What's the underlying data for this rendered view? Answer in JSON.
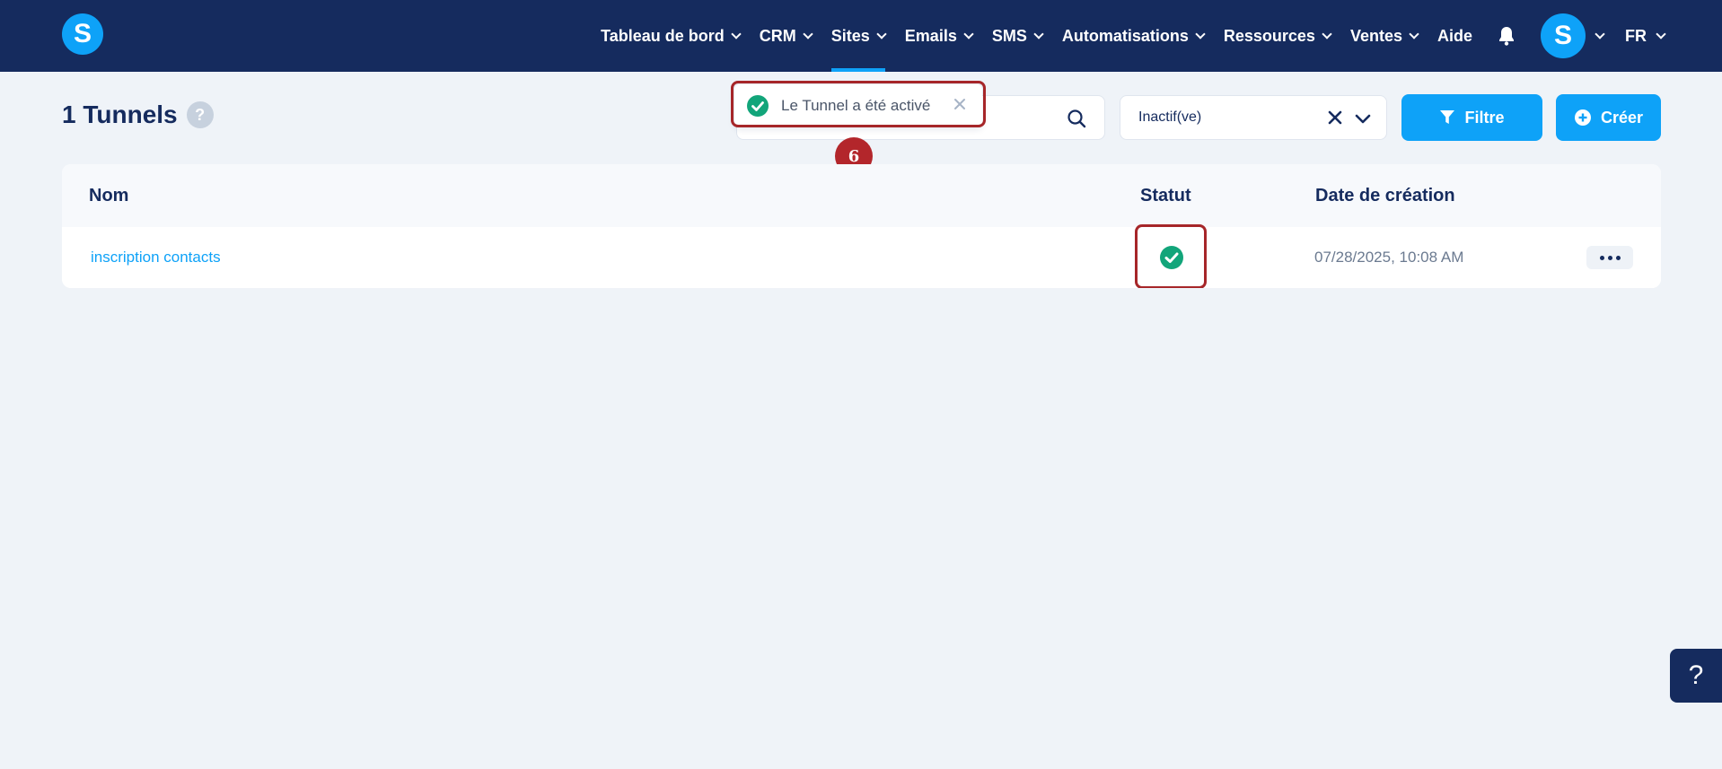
{
  "nav": {
    "items": [
      {
        "label": "Tableau de bord",
        "has_dropdown": true,
        "active": false
      },
      {
        "label": "CRM",
        "has_dropdown": true,
        "active": false
      },
      {
        "label": "Sites",
        "has_dropdown": true,
        "active": true
      },
      {
        "label": "Emails",
        "has_dropdown": true,
        "active": false
      },
      {
        "label": "SMS",
        "has_dropdown": true,
        "active": false
      },
      {
        "label": "Automatisations",
        "has_dropdown": true,
        "active": false
      },
      {
        "label": "Ressources",
        "has_dropdown": true,
        "active": false
      },
      {
        "label": "Ventes",
        "has_dropdown": true,
        "active": false
      },
      {
        "label": "Aide",
        "has_dropdown": false,
        "active": false
      }
    ],
    "logo_letter": "S",
    "avatar_letter": "S",
    "language": "FR"
  },
  "header": {
    "title": "1 Tunnels",
    "help_label": "?"
  },
  "filters": {
    "status_value": "Inactif(ve)",
    "filter_label": "Filtre",
    "create_label": "Créer"
  },
  "toast": {
    "message": "Le Tunnel a été activé",
    "close_label": "×"
  },
  "annotation": {
    "step_number": "6"
  },
  "table": {
    "columns": [
      "Nom",
      "Statut",
      "Date de création"
    ],
    "rows": [
      {
        "name": "inscription contacts",
        "status": "active",
        "created": "07/28/2025, 10:08 AM"
      }
    ]
  },
  "floating_help": {
    "label": "?"
  },
  "colors": {
    "navbar": "#152b5e",
    "accent": "#0ea2f8",
    "success": "#12a57a",
    "annotation": "#a62629",
    "background": "#eff3f8"
  }
}
